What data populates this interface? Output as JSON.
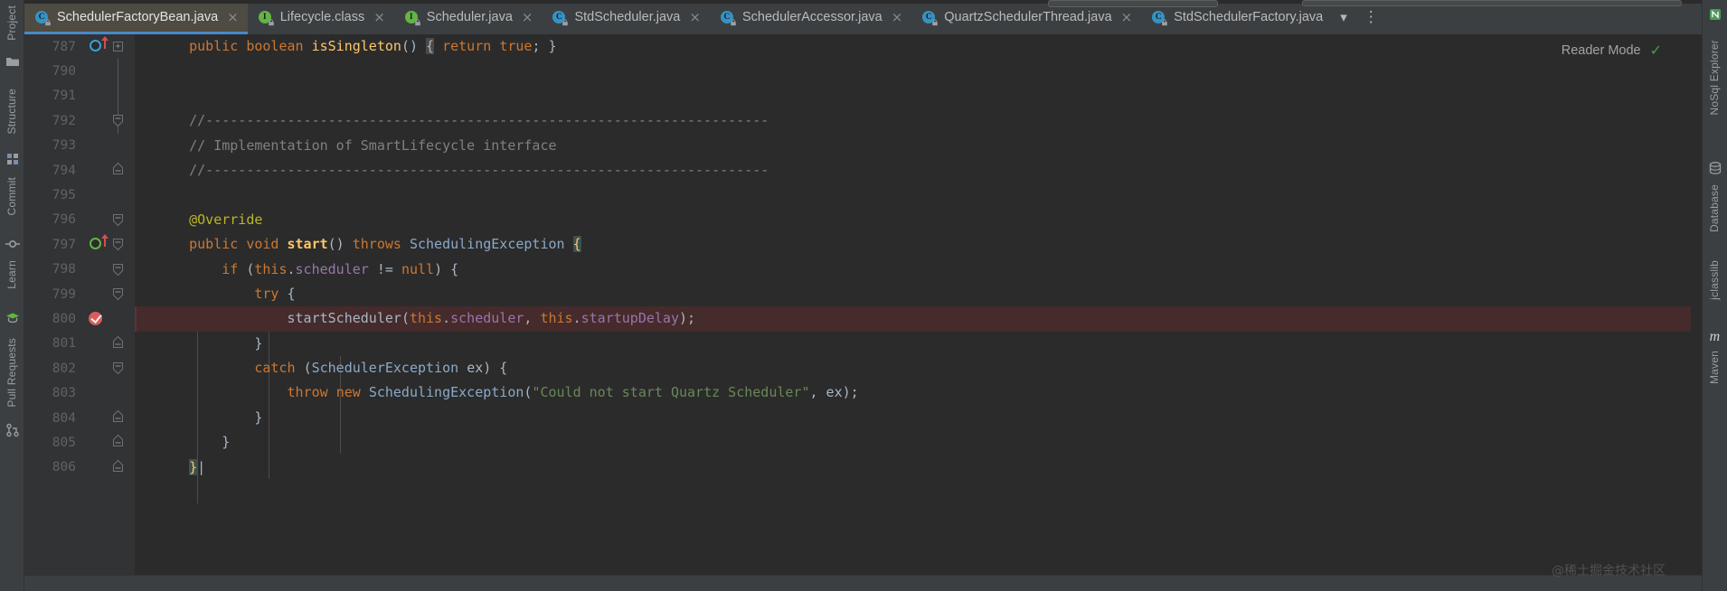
{
  "window": {
    "theme_bg": "#2b2b2b",
    "chrome_bg": "#3c3f41",
    "accent": "#4a88c7"
  },
  "left_toolbar": {
    "items": [
      {
        "label": "Project",
        "icon": "project-icon"
      },
      {
        "label": "",
        "icon": "folder-icon"
      },
      {
        "label": "Structure",
        "icon": "structure-icon"
      },
      {
        "label": "Commit",
        "icon": "commit-icon"
      },
      {
        "label": "Learn",
        "icon": "learn-icon"
      },
      {
        "label": "Pull Requests",
        "icon": "pull-request-icon"
      }
    ]
  },
  "right_toolbar": {
    "items": [
      {
        "label": "NoSql Explorer",
        "icon": "nosql-icon"
      },
      {
        "label": "Database",
        "icon": "database-icon"
      },
      {
        "label": "jclasslib",
        "icon": "jclasslib-icon"
      },
      {
        "label": "Maven",
        "icon": "maven-icon"
      }
    ]
  },
  "tabs": {
    "items": [
      {
        "label": "SchedulerFactoryBean.java",
        "icon_letter": "C",
        "icon_color": "#3592c4",
        "active": true,
        "close": "×"
      },
      {
        "label": "Lifecycle.class",
        "icon_letter": "I",
        "icon_color": "#62b543",
        "active": false,
        "close": "×"
      },
      {
        "label": "Scheduler.java",
        "icon_letter": "I",
        "icon_color": "#62b543",
        "active": false,
        "close": "×"
      },
      {
        "label": "StdScheduler.java",
        "icon_letter": "C",
        "icon_color": "#3592c4",
        "active": false,
        "close": "×"
      },
      {
        "label": "SchedulerAccessor.java",
        "icon_letter": "C",
        "icon_color": "#3592c4",
        "active": false,
        "close": "×"
      },
      {
        "label": "QuartzSchedulerThread.java",
        "icon_letter": "C",
        "icon_color": "#3592c4",
        "active": false,
        "close": "×"
      },
      {
        "label": "StdSchedulerFactory.java",
        "icon_letter": "C",
        "icon_color": "#3592c4",
        "active": false,
        "close": ""
      }
    ],
    "overflow_chevron": "▾",
    "more_menu": "⋮"
  },
  "editor": {
    "reader_mode_label": "Reader Mode",
    "reader_mode_check": "✓",
    "watermark": "@稀土掘金技术社区",
    "line_numbers": [
      "787",
      "790",
      "791",
      "792",
      "793",
      "794",
      "795",
      "796",
      "797",
      "798",
      "799",
      "800",
      "801",
      "802",
      "803",
      "804",
      "805",
      "806"
    ],
    "lines": [
      {
        "no": "787",
        "text": "    public boolean isSingleton() { return true; }"
      },
      {
        "no": "790",
        "text": ""
      },
      {
        "no": "791",
        "text": ""
      },
      {
        "no": "792",
        "text": "    //---------------------------------------------------------------------"
      },
      {
        "no": "793",
        "text": "    // Implementation of SmartLifecycle interface"
      },
      {
        "no": "794",
        "text": "    //---------------------------------------------------------------------"
      },
      {
        "no": "795",
        "text": ""
      },
      {
        "no": "796",
        "text": "    @Override"
      },
      {
        "no": "797",
        "text": "    public void start() throws SchedulingException {"
      },
      {
        "no": "798",
        "text": "        if (this.scheduler != null) {"
      },
      {
        "no": "799",
        "text": "            try {"
      },
      {
        "no": "800",
        "text": "                startScheduler(this.scheduler, this.startupDelay);"
      },
      {
        "no": "801",
        "text": "            }"
      },
      {
        "no": "802",
        "text": "            catch (SchedulerException ex) {"
      },
      {
        "no": "803",
        "text": "                throw new SchedulingException(\"Could not start Quartz Scheduler\", ex);"
      },
      {
        "no": "804",
        "text": "            }"
      },
      {
        "no": "805",
        "text": "        }"
      },
      {
        "no": "806",
        "text": "    }"
      }
    ],
    "breakpoint_line": "800",
    "caret_line": "806",
    "syntax_colors": {
      "keyword": "#cc7832",
      "method": "#ffc66d",
      "field": "#9876aa",
      "string": "#6a8759",
      "comment": "#808080",
      "annotation": "#bbb529",
      "class_ref": "#8aa9c9",
      "plain": "#a9b7c6",
      "breakpoint_row": "#452b2b"
    }
  }
}
